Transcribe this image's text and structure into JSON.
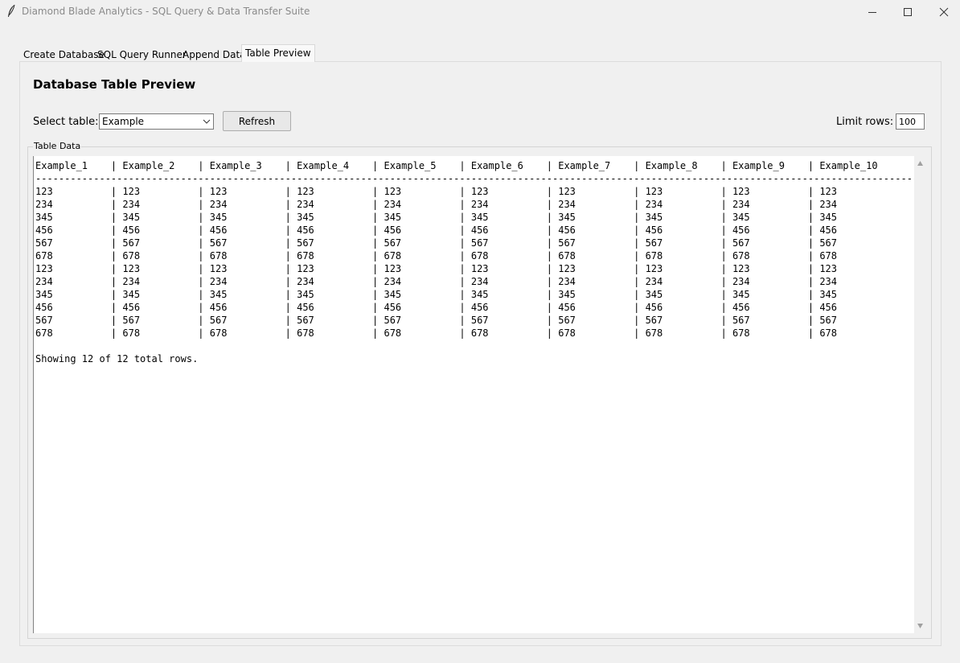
{
  "window": {
    "title": "Diamond Blade Analytics - SQL Query & Data Transfer Suite"
  },
  "tabs": [
    {
      "label": "Create Database"
    },
    {
      "label": "SQL Query Runner"
    },
    {
      "label": "Append Data"
    },
    {
      "label": "Table Preview",
      "selected": true
    }
  ],
  "page": {
    "title": "Database Table Preview",
    "select_label": "Select table:",
    "selected_table": "Example",
    "refresh_label": "Refresh",
    "limit_label": "Limit rows:",
    "limit_value": "100",
    "group_label": "Table Data"
  },
  "table": {
    "columns": [
      "Example_1",
      "Example_2",
      "Example_3",
      "Example_4",
      "Example_5",
      "Example_6",
      "Example_7",
      "Example_8",
      "Example_9",
      "Example_10"
    ],
    "rows": [
      [
        "123",
        "123",
        "123",
        "123",
        "123",
        "123",
        "123",
        "123",
        "123",
        "123"
      ],
      [
        "234",
        "234",
        "234",
        "234",
        "234",
        "234",
        "234",
        "234",
        "234",
        "234"
      ],
      [
        "345",
        "345",
        "345",
        "345",
        "345",
        "345",
        "345",
        "345",
        "345",
        "345"
      ],
      [
        "456",
        "456",
        "456",
        "456",
        "456",
        "456",
        "456",
        "456",
        "456",
        "456"
      ],
      [
        "567",
        "567",
        "567",
        "567",
        "567",
        "567",
        "567",
        "567",
        "567",
        "567"
      ],
      [
        "678",
        "678",
        "678",
        "678",
        "678",
        "678",
        "678",
        "678",
        "678",
        "678"
      ],
      [
        "123",
        "123",
        "123",
        "123",
        "123",
        "123",
        "123",
        "123",
        "123",
        "123"
      ],
      [
        "234",
        "234",
        "234",
        "234",
        "234",
        "234",
        "234",
        "234",
        "234",
        "234"
      ],
      [
        "345",
        "345",
        "345",
        "345",
        "345",
        "345",
        "345",
        "345",
        "345",
        "345"
      ],
      [
        "456",
        "456",
        "456",
        "456",
        "456",
        "456",
        "456",
        "456",
        "456",
        "456"
      ],
      [
        "567",
        "567",
        "567",
        "567",
        "567",
        "567",
        "567",
        "567",
        "567",
        "567"
      ],
      [
        "678",
        "678",
        "678",
        "678",
        "678",
        "678",
        "678",
        "678",
        "678",
        "678"
      ]
    ],
    "status": "Showing 12 of 12 total rows."
  },
  "icons": {
    "app": "feather-icon",
    "minimize": "minimize-icon",
    "maximize": "maximize-icon",
    "close": "close-icon",
    "dropdown": "chevron-down-icon",
    "scroll_up": "scroll-up-arrow-icon",
    "scroll_down": "scroll-down-arrow-icon"
  }
}
